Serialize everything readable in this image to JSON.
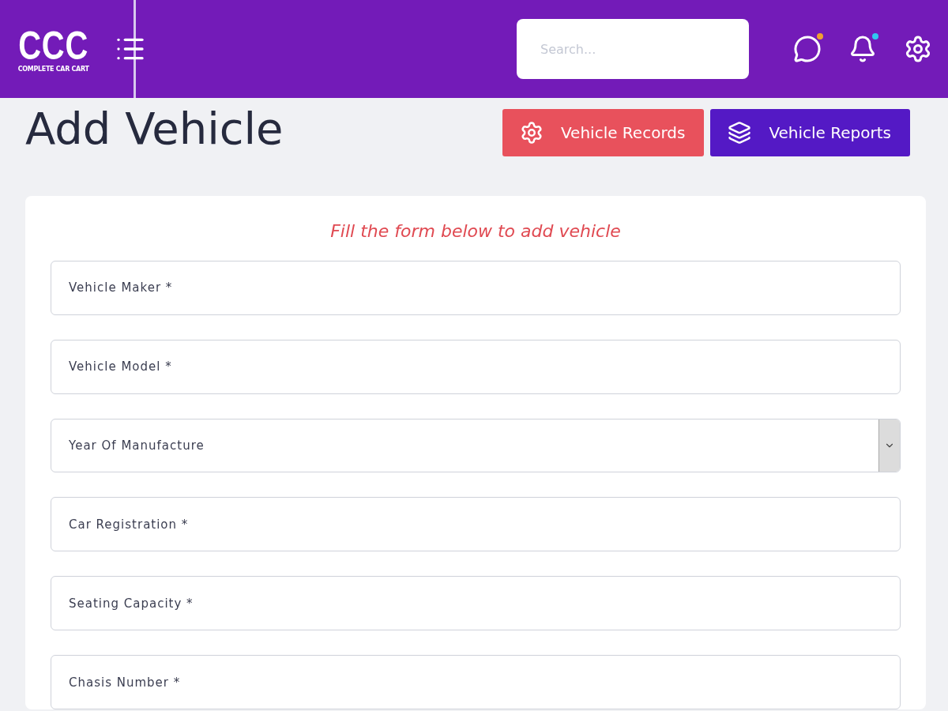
{
  "header": {
    "logo": {
      "letters": "CCC",
      "tagline": "COMPLETE CAR CART"
    },
    "search": {
      "placeholder": "Search..."
    },
    "icons": [
      {
        "kind": "chat",
        "color": "#f0a030"
      },
      {
        "kind": "bell",
        "color": "#30c8f0"
      },
      {
        "kind": "settings"
      }
    ]
  },
  "page": {
    "title": "Add Vehicle",
    "buttons": [
      {
        "label": "Vehicle Records",
        "kind": "records"
      },
      {
        "label": "Vehicle Reports",
        "kind": "reports"
      }
    ]
  },
  "form": {
    "subtitle": "Fill the form below to add vehicle",
    "fields": [
      {
        "label": "Vehicle Maker *",
        "kind": "text"
      },
      {
        "label": "Vehicle Model *",
        "kind": "text"
      },
      {
        "label": "Year Of Manufacture",
        "kind": "select"
      },
      {
        "label": "Car Registration *",
        "kind": "text"
      },
      {
        "label": "Seating Capacity *",
        "kind": "text"
      },
      {
        "label": "Chasis Number *",
        "kind": "text"
      }
    ]
  }
}
